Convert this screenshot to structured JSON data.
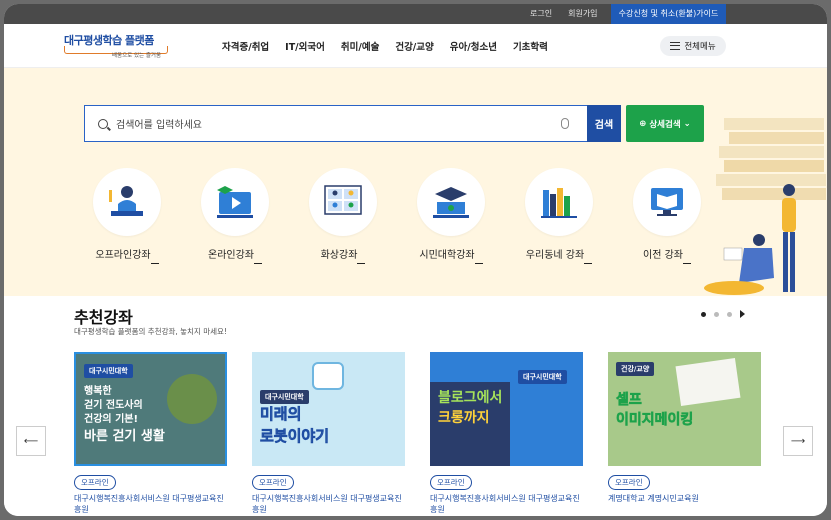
{
  "topbar": {
    "login": "로그인",
    "join": "회원가입",
    "guide": "수강신청 및 취소(환불)가이드"
  },
  "header": {
    "logo_title": "대구평생학습 플랫폼",
    "logo_slogan": "배움으로 있는 즐거움",
    "nav": [
      "자격증/취업",
      "IT/외국어",
      "취미/예술",
      "건강/교양",
      "유아/청소년",
      "기초학력"
    ],
    "all_menu": "전체메뉴"
  },
  "search": {
    "placeholder": "검색어를 입력하세요",
    "button": "검색",
    "detail_button": "상세검색"
  },
  "categories": [
    {
      "label": "오프라인강좌",
      "icon": "offline-lecture-icon"
    },
    {
      "label": "온라인강좌",
      "icon": "online-lecture-icon"
    },
    {
      "label": "화상강좌",
      "icon": "video-lecture-icon"
    },
    {
      "label": "시민대학강좌",
      "icon": "citizen-university-icon"
    },
    {
      "label": "우리동네 강좌",
      "icon": "neighborhood-lecture-icon"
    },
    {
      "label": "이전 강좌",
      "icon": "past-lecture-icon"
    }
  ],
  "recommended": {
    "title": "추천강좌",
    "subtitle": "대구평생학습 플랫폼의 추천강좌, 놓치지 마세요!",
    "cards": [
      {
        "tag": "대구시민대학",
        "text1": "행복한",
        "text2": "걷기 전도사의",
        "text3": "건강의 기본!",
        "text4": "바른 걷기 생활",
        "badge": "오프라인",
        "org": "대구시행복진흥사회서비스원 대구평생교육진흥원"
      },
      {
        "tag": "대구시민대학",
        "text1": "미래의",
        "text2": "로봇이야기",
        "badge": "오프라인",
        "org": "대구시행복진흥사회서비스원 대구평생교육진흥원"
      },
      {
        "tag": "대구시민대학",
        "text1": "블로그에서",
        "text2": "크롱까지",
        "badge": "오프라인",
        "org": "대구시행복진흥사회서비스원 대구평생교육진흥원"
      },
      {
        "tag": "건강/교양",
        "text1": "셀프",
        "text2": "이미지메이킹",
        "badge": "오프라인",
        "org": "계명대학교 계명시민교육원"
      }
    ]
  },
  "colors": {
    "brand_blue": "#1f4ea3",
    "green": "#1da24a",
    "hero_bg": "#fff6e1"
  }
}
